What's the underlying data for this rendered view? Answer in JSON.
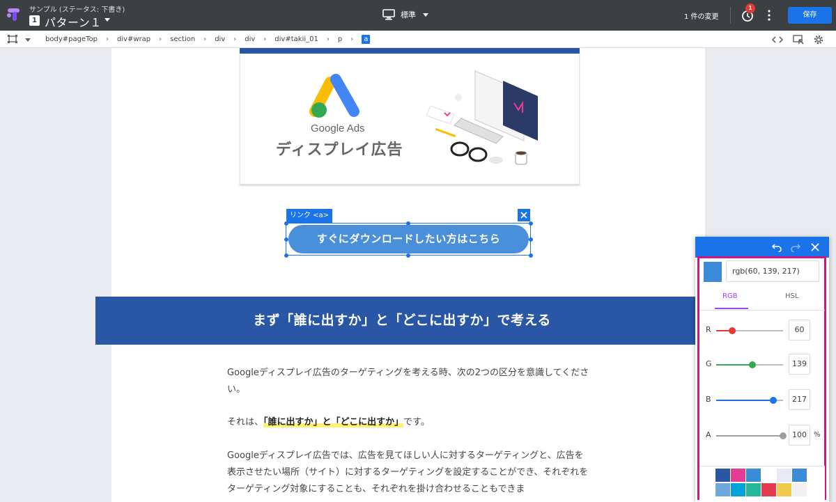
{
  "header": {
    "subtitle": "サンプル (ステータス: 下書き)",
    "variant_number": "1",
    "variant_name": "パターン１",
    "device_label": "標準",
    "changes_label": "1 件の変更",
    "history_badge": "1",
    "save_label": "保存"
  },
  "breadcrumbs": {
    "items": [
      "body#pageTop",
      "div#wrap",
      "section",
      "div",
      "div",
      "div#takii_01",
      "p",
      "a"
    ]
  },
  "content": {
    "google_ads_text": "Google Ads",
    "display_ad_text": "ディスプレイ広告",
    "selection_label": "リンク <a>",
    "cta_label": "すぐにダウンロードしたい方はこちら",
    "section_heading": "まず「誰に出すか」と「どこに出すか」で考える",
    "para1": "Googleディスプレイ広告のターゲティングを考える時、次の2つの区分を意識してください。",
    "para2_prefix": "それは、",
    "para2_highlight": "「誰に出すか」と「どこに出すか」",
    "para2_suffix": "です。",
    "para3": "Googleディスプレイ広告では、広告を見てほしい人に対するターゲティングと、広告を表示させたい場所（サイト）に対するターゲティングを設定することができ、それぞれをターゲティング対象にすることも、それぞれを掛け合わせることもできま"
  },
  "picker": {
    "color_value": "rgb(60, 139, 217)",
    "swatch_color": "#3c8bd9",
    "tabs": {
      "rgb": "RGB",
      "hsl": "HSL"
    },
    "channels": [
      {
        "label": "R",
        "value": "60",
        "fraction": 0.235,
        "color": "#e53935"
      },
      {
        "label": "G",
        "value": "139",
        "fraction": 0.545,
        "color": "#34a853"
      },
      {
        "label": "B",
        "value": "217",
        "fraction": 0.851,
        "color": "#1a73e8"
      },
      {
        "label": "A",
        "value": "100",
        "fraction": 1.0,
        "color": "#9e9e9e"
      }
    ],
    "percent_sign": "%",
    "presets": [
      "#2957a6",
      "#e43d96",
      "#3c8bd9",
      "#ffffff",
      "#e8eaf6",
      "#3c8bd9",
      "#6fa8dc",
      "#00a3d9",
      "#26b89a",
      "#e53950",
      "#f2c94c",
      "#f0f0f0"
    ]
  },
  "colors": {
    "accent": "#1a73e8",
    "frame": "#d3137f",
    "heading_bg": "#2957a6"
  }
}
